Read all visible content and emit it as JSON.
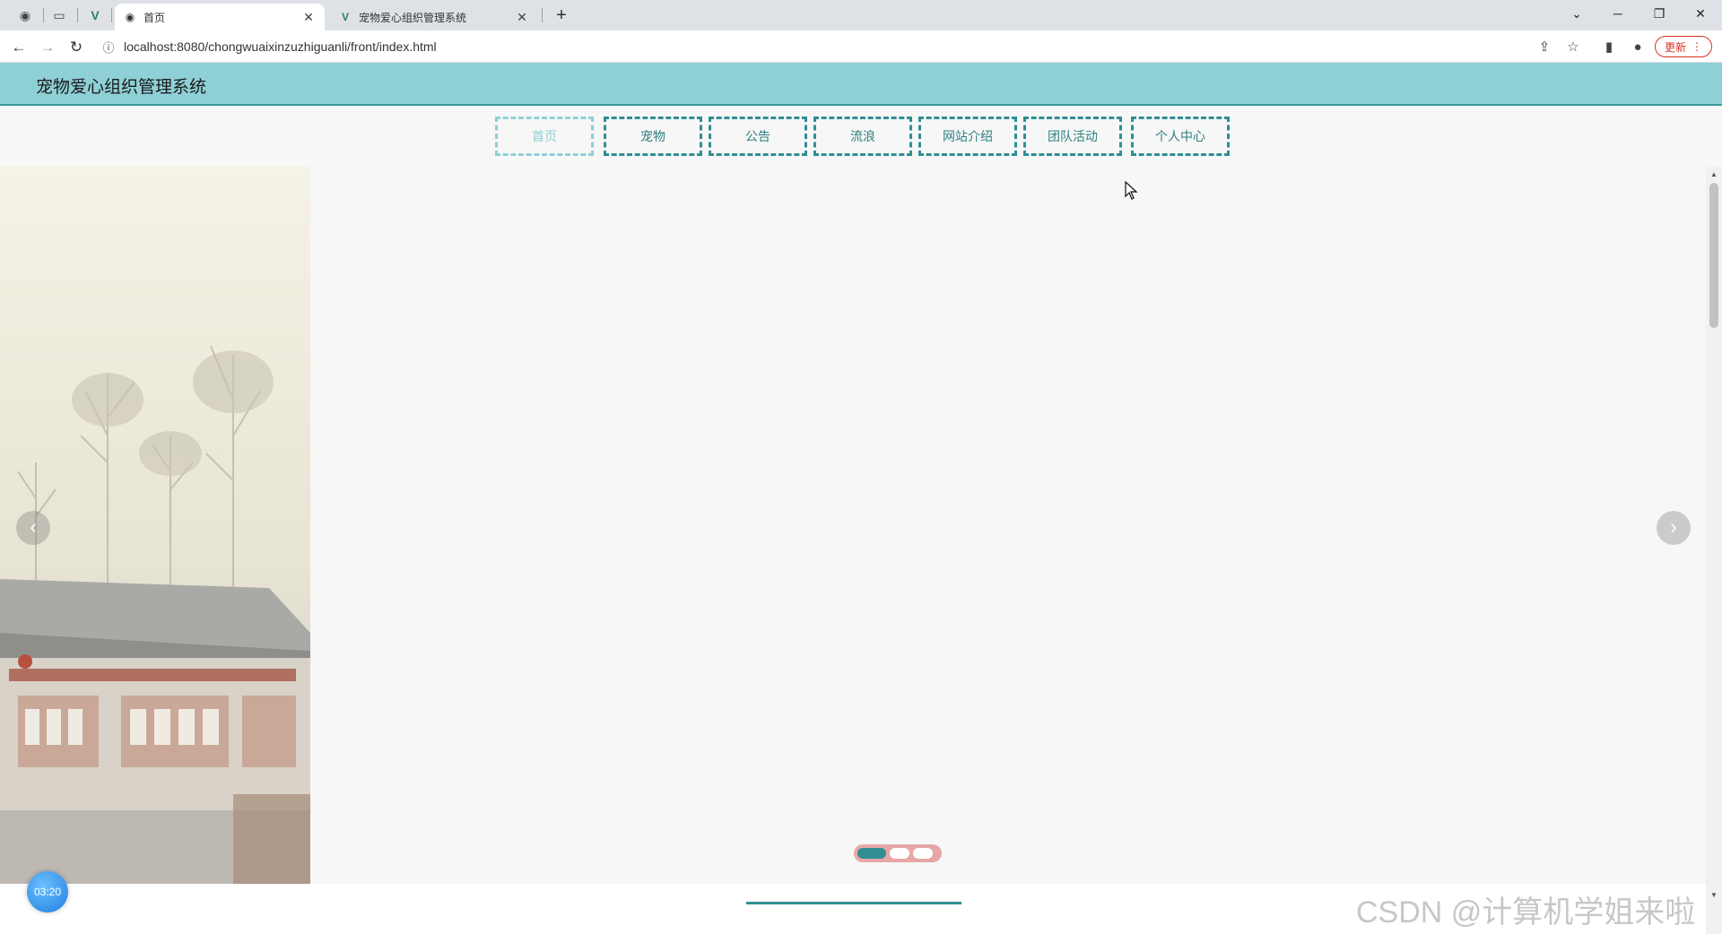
{
  "browser": {
    "tabs": [
      {
        "title": "首页",
        "active": true
      },
      {
        "title": "宠物爱心组织管理系统",
        "active": false
      }
    ],
    "url": "localhost:8080/chongwuaixinzuzhiguanli/front/index.html",
    "update_label": "更新",
    "icons": {
      "back": "back-arrow-icon",
      "forward": "forward-arrow-icon",
      "reload": "reload-icon",
      "info": "info-icon",
      "share": "share-icon",
      "star": "star-icon",
      "sidepanel": "side-panel-icon",
      "profile": "profile-icon",
      "menu": "kebab-menu-icon"
    }
  },
  "site": {
    "title": "宠物爱心组织管理系统",
    "nav": [
      {
        "label": "首页",
        "active": true
      },
      {
        "label": "宠物",
        "active": false
      },
      {
        "label": "公告",
        "active": false
      },
      {
        "label": "流浪",
        "active": false
      },
      {
        "label": "网站介绍",
        "active": false
      },
      {
        "label": "团队活动",
        "active": false
      },
      {
        "label": "个人中心",
        "active": false
      }
    ],
    "carousel": {
      "prev": "‹",
      "next": "›",
      "slide_count": 3,
      "active_index": 0
    }
  },
  "overlay": {
    "timer": "03:20",
    "watermark": "CSDN @计算机学姐来啦"
  },
  "colors": {
    "header_bg": "#8ed0d6",
    "accent": "#2f8f92",
    "nav_active": "#8ed0d6",
    "indicator_bg": "#e7a7a7"
  }
}
